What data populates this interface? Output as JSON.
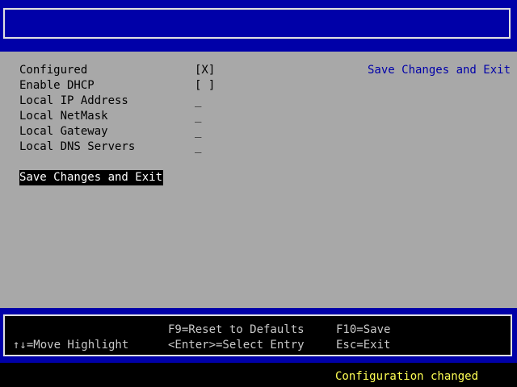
{
  "settings": {
    "rows": [
      {
        "label": "Configured",
        "value": "[X]"
      },
      {
        "label": "Enable DHCP",
        "value": "[ ]"
      },
      {
        "label": "Local IP Address",
        "value": "_"
      },
      {
        "label": "Local NetMask",
        "value": "_"
      },
      {
        "label": "Local Gateway",
        "value": "_"
      },
      {
        "label": "Local DNS Servers",
        "value": "_"
      }
    ],
    "action_label": "Save Changes and Exit"
  },
  "help": {
    "text": "Save Changes and Exit"
  },
  "keys": {
    "move": "↑↓=Move Highlight",
    "reset": "F9=Reset to Defaults",
    "select": "<Enter>=Select Entry",
    "save": "F10=Save",
    "exit": "Esc=Exit"
  },
  "status": {
    "message": "Configuration changed"
  },
  "colors": {
    "band": "#0000a8",
    "body": "#a8a8a8",
    "help_text": "#0000a8",
    "status_text": "#ffff54"
  }
}
